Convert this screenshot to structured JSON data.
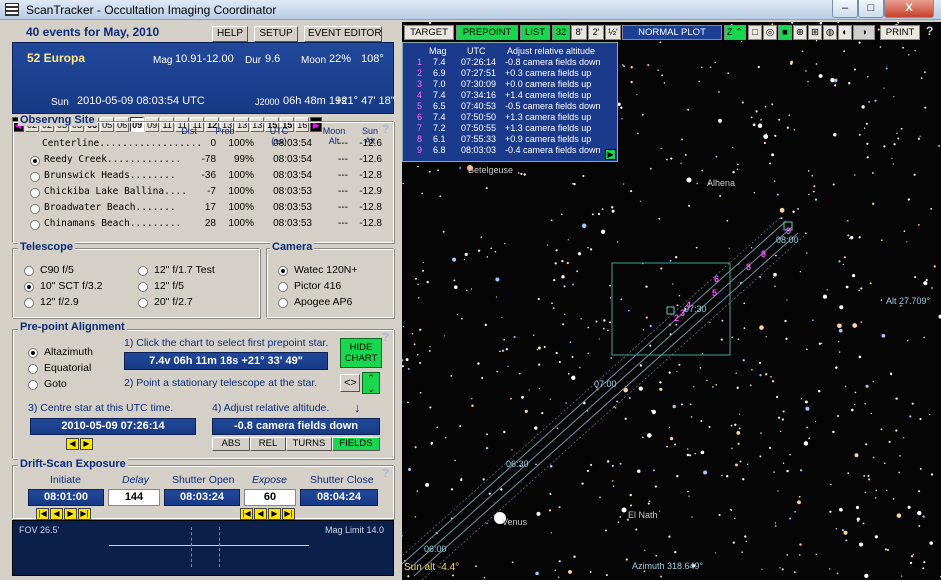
{
  "window": {
    "title": "ScanTracker - Occultation Imaging Coordinator",
    "min": "–",
    "max": "□",
    "close": "X"
  },
  "header": {
    "events": "40 events for May, 2010",
    "help": "HELP",
    "setup": "SETUP",
    "event_editor": "EVENT EDITOR"
  },
  "event": {
    "name": "52 Europa",
    "mag_label": "Mag",
    "mag": "10.91-12.00",
    "dur_label": "Dur",
    "dur": "9.6",
    "moon_label": "Moon",
    "moon_pct": "22%",
    "moon_deg": "108°",
    "sun_label": "Sun",
    "datetime": "2010-05-09  08:03:54 UTC",
    "j2000_label": "J2000",
    "ra": "06h 48m 19s",
    "dec": "+21° 47' 18\""
  },
  "dates": [
    "02",
    "02",
    "03",
    "03",
    "05",
    "05",
    "06",
    "09",
    "09",
    "11",
    "11",
    "11",
    "12",
    "13",
    "13",
    "13",
    "15",
    "15",
    "16"
  ],
  "site": {
    "legend": "Observng Site",
    "cols": {
      "dist": "Dist",
      "prob": "Prob",
      "utc": "UTC",
      "utc2": "(±s)",
      "moon": "Moon",
      "moon2": "Alt",
      "sun": "Sun",
      "sun2": "Alt"
    },
    "rows": [
      {
        "name": "Centerline..................",
        "dist": "0",
        "prob": "100%",
        "utc": "08:03:54",
        "moon": "---",
        "sun": "-12.6"
      },
      {
        "name": "Reedy Creek.............",
        "dist": "-78",
        "prob": "99%",
        "utc": "08:03:54",
        "moon": "---",
        "sun": "-12.6"
      },
      {
        "name": "Brunswick Heads........",
        "dist": "-36",
        "prob": "100%",
        "utc": "08:03:54",
        "moon": "---",
        "sun": "-12.8"
      },
      {
        "name": "Chickiba Lake Ballina....",
        "dist": "-7",
        "prob": "100%",
        "utc": "08:03:53",
        "moon": "---",
        "sun": "-12.9"
      },
      {
        "name": "Broadwater Beach.......",
        "dist": "17",
        "prob": "100%",
        "utc": "08:03:53",
        "moon": "---",
        "sun": "-12.8"
      },
      {
        "name": "Chinamans Beach.........",
        "dist": "28",
        "prob": "100%",
        "utc": "08:03:53",
        "moon": "---",
        "sun": "-12.8"
      }
    ]
  },
  "telescope": {
    "legend": "Telescope",
    "opts": [
      "C90 f/5",
      "12\" f/1.7 Test",
      "10\" SCT f/3.2",
      "12\" f/5",
      "12\" f/2.9",
      "20\" f/2.7"
    ]
  },
  "camera": {
    "legend": "Camera",
    "opts": [
      "Watec 120N+",
      "Pictor 416",
      "Apogee AP6"
    ]
  },
  "prepoint": {
    "legend": "Pre-point Alignment",
    "mounts": [
      "Altazimuth",
      "Equatorial",
      "Goto"
    ],
    "step1": "1)  Click the chart to select first prepoint star.",
    "star": "7.4v  06h 11m 18s  +21° 33' 49\"",
    "step2": "2)  Point a stationary telescope at the star.",
    "step3": "3)  Centre star at this UTC time.",
    "step4": "4)  Adjust relative altitude.",
    "utc": "2010-05-09     07:26:14",
    "alt": "-0.8 camera fields down",
    "hide": "HIDE CHART",
    "segs": [
      "ABS",
      "REL",
      "TURNS",
      "FIELDS"
    ]
  },
  "drift": {
    "legend": "Drift-Scan Exposure",
    "initiate_label": "Initiate",
    "delay_label": "Delay",
    "open_label": "Shutter Open",
    "expose_label": "Expose",
    "close_label": "Shutter Close",
    "initiate": "08:01:00",
    "delay": "144",
    "open": "08:03:24",
    "expose": "60",
    "close": "08:04:24"
  },
  "strip": {
    "fov": "FOV 26.5'",
    "maglimit": "Mag Limit 14.0"
  },
  "chart": {
    "toolbar": [
      "TARGET",
      "PREPOINT",
      "LIST",
      "32",
      "8'",
      "2'",
      "½'",
      "NORMAL PLOT",
      "Z ⌃",
      "PRINT"
    ],
    "pp_headers": [
      "Mag",
      "UTC",
      "Adjust relative altitude"
    ],
    "pp_rows": [
      [
        "1",
        "7.4",
        "07:26:14",
        "-0.8 camera fields down"
      ],
      [
        "2",
        "6.9",
        "07:27:51",
        "+0.3 camera fields up"
      ],
      [
        "3",
        "7.0",
        "07:30:09",
        "+0.0 camera fields up"
      ],
      [
        "4",
        "7.4",
        "07:34:16",
        "+1.4 camera fields up"
      ],
      [
        "5",
        "6.5",
        "07:40:53",
        "-0.5 camera fields down"
      ],
      [
        "6",
        "7.4",
        "07:50:50",
        "+1.3 camera fields up"
      ],
      [
        "7",
        "7.2",
        "07:50:55",
        "+1.3 camera fields up"
      ],
      [
        "8",
        "6.1",
        "07:55:33",
        "+0.9 camera fields up"
      ],
      [
        "9",
        "6.8",
        "08:03:03",
        "-0.4 camera fields down"
      ]
    ],
    "labels": {
      "betelgeuse": "Betelgeuse",
      "alhena": "Alhena",
      "venus": "Venus",
      "elnath": "El Nath",
      "alt": "Alt  27.709°",
      "azimuth": "Azimuth  318.649°",
      "sunalt": "Sun alt -4.4°",
      "t0800": "08:00",
      "t0730": "07:30",
      "t0700": "07:00",
      "t0630": "06:30",
      "t0600": "06:00"
    },
    "path_markers": [
      "9",
      "8",
      "8",
      "6",
      "5",
      "4",
      "3",
      "2"
    ]
  }
}
